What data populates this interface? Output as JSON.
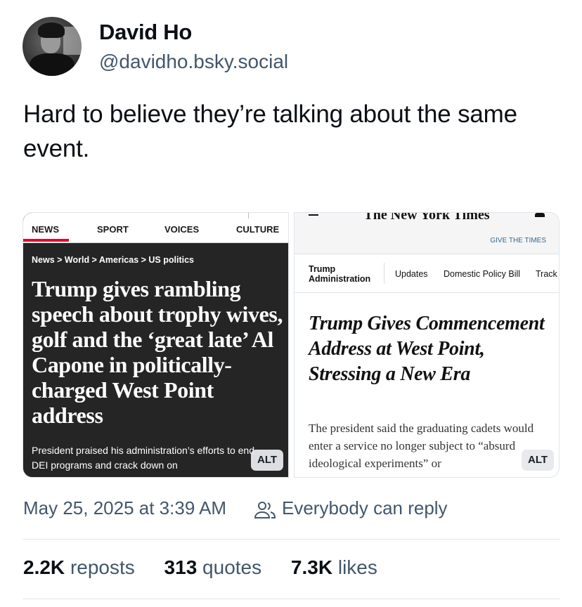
{
  "author": {
    "display_name": "David Ho",
    "handle": "@davidho.bsky.social"
  },
  "post": {
    "text": "Hard to believe they’re talking about the same event."
  },
  "images": {
    "left": {
      "nav": [
        "NEWS",
        "SPORT",
        "VOICES",
        "CULTURE"
      ],
      "breadcrumb": "News > World > Americas > US politics",
      "headline": "Trump gives rambling speech about trophy wives, golf and the ‘great late’ Al Capone in politically-charged West Point address",
      "subhead": "President praised his administration’s efforts to end DEI programs and crack down on",
      "alt": "ALT"
    },
    "right": {
      "masthead": "The New York Times",
      "give": "GIVE THE TIMES",
      "section": "Trump Administration",
      "nav": [
        "Updates",
        "Domestic Policy Bill",
        "Track"
      ],
      "headline": "Trump Gives Commencement Address at West Point, Stressing a New Era",
      "subhead": "The president said the graduating cadets would enter a service no longer subject to “absurd ideological experiments” or",
      "alt": "ALT"
    }
  },
  "meta": {
    "timestamp": "May 25, 2025 at 3:39 AM",
    "reply_setting": "Everybody can reply",
    "reply_icon": "people-icon"
  },
  "stats": {
    "reposts_count": "2.2K",
    "reposts_label": "reposts",
    "quotes_count": "313",
    "quotes_label": "quotes",
    "likes_count": "7.3K",
    "likes_label": "likes"
  },
  "colors": {
    "muted_text": "#42576c",
    "independent_red": "#e4002b",
    "nyt_link": "#326891"
  }
}
